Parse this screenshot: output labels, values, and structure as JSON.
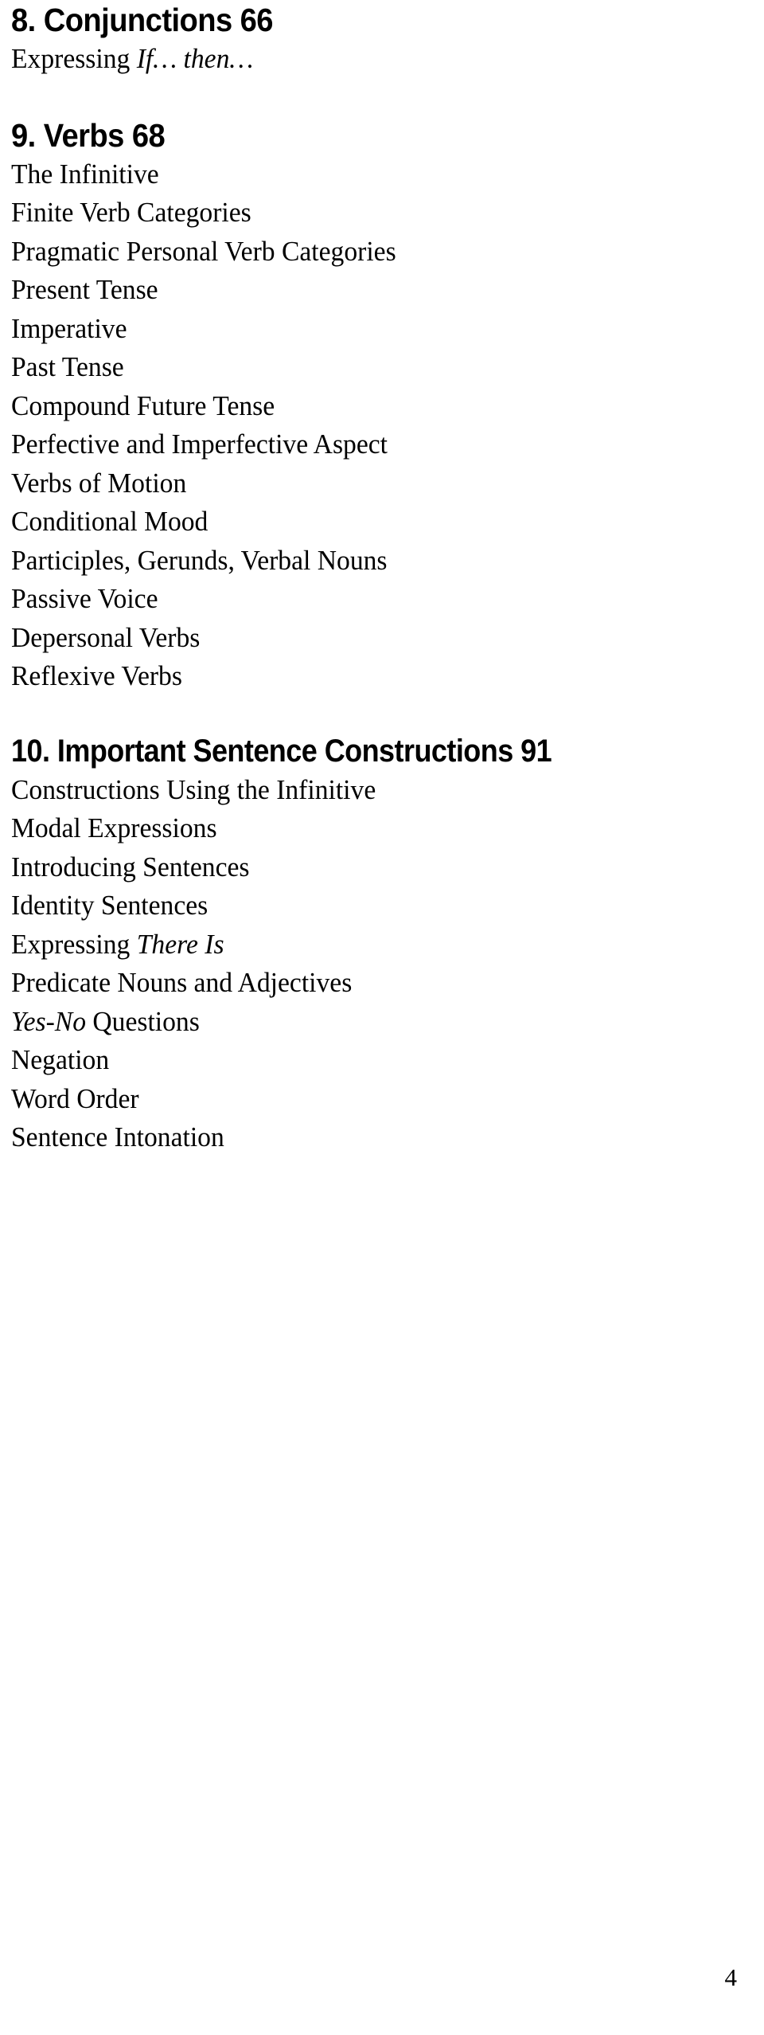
{
  "document": {
    "type": "table-of-contents",
    "page_number": "4",
    "sections": [
      {
        "heading": "8. Conjunctions 66",
        "number": "8.",
        "title": "Conjunctions",
        "page": "66",
        "entries": [
          {
            "prefix": "Expressing ",
            "italic": "If… then…",
            "suffix": ""
          }
        ]
      },
      {
        "heading": "9. Verbs 68",
        "number": "9.",
        "title": "Verbs",
        "page": "68",
        "entries": [
          {
            "prefix": "The Infinitive",
            "italic": "",
            "suffix": ""
          },
          {
            "prefix": "Finite Verb Categories",
            "italic": "",
            "suffix": ""
          },
          {
            "prefix": "Pragmatic Personal Verb Categories",
            "italic": "",
            "suffix": ""
          },
          {
            "prefix": "Present Tense",
            "italic": "",
            "suffix": ""
          },
          {
            "prefix": "Imperative",
            "italic": "",
            "suffix": ""
          },
          {
            "prefix": "Past Tense",
            "italic": "",
            "suffix": ""
          },
          {
            "prefix": "Compound Future Tense",
            "italic": "",
            "suffix": ""
          },
          {
            "prefix": "Perfective and Imperfective Aspect",
            "italic": "",
            "suffix": ""
          },
          {
            "prefix": "Verbs of Motion",
            "italic": "",
            "suffix": ""
          },
          {
            "prefix": "Conditional Mood",
            "italic": "",
            "suffix": ""
          },
          {
            "prefix": "Participles, Gerunds, Verbal Nouns",
            "italic": "",
            "suffix": ""
          },
          {
            "prefix": "Passive Voice",
            "italic": "",
            "suffix": ""
          },
          {
            "prefix": "Depersonal Verbs",
            "italic": "",
            "suffix": ""
          },
          {
            "prefix": "Reflexive Verbs",
            "italic": "",
            "suffix": ""
          }
        ]
      },
      {
        "heading": "10. Important Sentence Constructions 91",
        "number": "10.",
        "title": "Important Sentence Constructions",
        "page": "91",
        "entries": [
          {
            "prefix": "Constructions Using the Infinitive",
            "italic": "",
            "suffix": ""
          },
          {
            "prefix": "Modal Expressions",
            "italic": "",
            "suffix": ""
          },
          {
            "prefix": "Introducing Sentences",
            "italic": "",
            "suffix": ""
          },
          {
            "prefix": "Identity Sentences",
            "italic": "",
            "suffix": ""
          },
          {
            "prefix": "Expressing ",
            "italic": "There Is",
            "suffix": ""
          },
          {
            "prefix": "Predicate Nouns and Adjectives",
            "italic": "",
            "suffix": ""
          },
          {
            "prefix": "",
            "italic": "Yes-No",
            "suffix": " Questions"
          },
          {
            "prefix": "Negation",
            "italic": "",
            "suffix": ""
          },
          {
            "prefix": "Word Order",
            "italic": "",
            "suffix": ""
          },
          {
            "prefix": "Sentence Intonation",
            "italic": "",
            "suffix": ""
          }
        ]
      }
    ]
  }
}
